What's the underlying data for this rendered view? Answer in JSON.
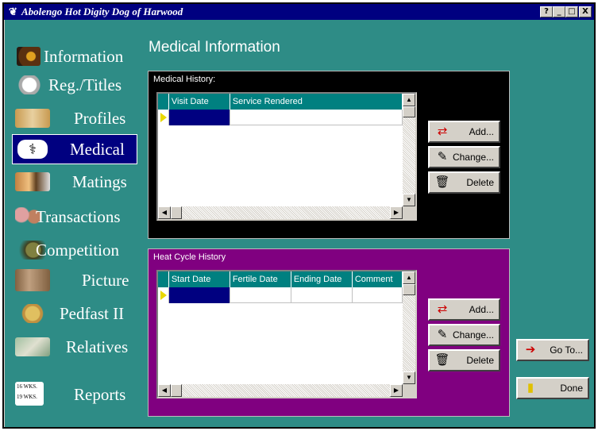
{
  "window": {
    "title": "Abolengo Hot Digity Dog of Harwood",
    "help_btn": "?",
    "min_btn": "_",
    "max_btn": "□",
    "close_btn": "X"
  },
  "sidebar": {
    "items": [
      {
        "label": "Information",
        "icon": "information-photo-icon"
      },
      {
        "label": "Reg./Titles",
        "icon": "registration-ribbon-icon"
      },
      {
        "label": "Profiles",
        "icon": "cat-silhouette-icon"
      },
      {
        "label": "Medical",
        "icon": "caduceus-icon"
      },
      {
        "label": "Matings",
        "icon": "cats-photo-icon"
      },
      {
        "label": "Transactions",
        "icon": "transactions-icon"
      },
      {
        "label": "Competition",
        "icon": "competition-cat-icon"
      },
      {
        "label": "Picture",
        "icon": "cat-picture-icon"
      },
      {
        "label": "Pedfast II",
        "icon": "pedfast-logo-icon"
      },
      {
        "label": "Relatives",
        "icon": "relatives-photo-icon"
      },
      {
        "label": "Reports",
        "icon": "reports-icon"
      }
    ],
    "reports_icon_text": [
      "16 WKS.",
      "19 WKS."
    ],
    "active": "Medical"
  },
  "page": {
    "heading": "Medical Information"
  },
  "medical_history": {
    "title": "Medical History:",
    "columns": [
      "Visit Date",
      "Service Rendered"
    ],
    "rows": [
      [
        "",
        ""
      ]
    ]
  },
  "heat_cycle": {
    "title": "Heat Cycle History",
    "columns": [
      "Start Date",
      "Fertile Date",
      "Ending Date",
      "Comment"
    ],
    "rows": [
      [
        "",
        "",
        "",
        ""
      ]
    ]
  },
  "buttons": {
    "add": "Add...",
    "change": "Change...",
    "delete": "Delete",
    "goto": "Go To...",
    "done": "Done"
  },
  "colors": {
    "background": "#2e8c86",
    "medical_panel": "#000000",
    "heat_panel": "#800080",
    "grid_header": "#008080",
    "selection": "#000080"
  }
}
